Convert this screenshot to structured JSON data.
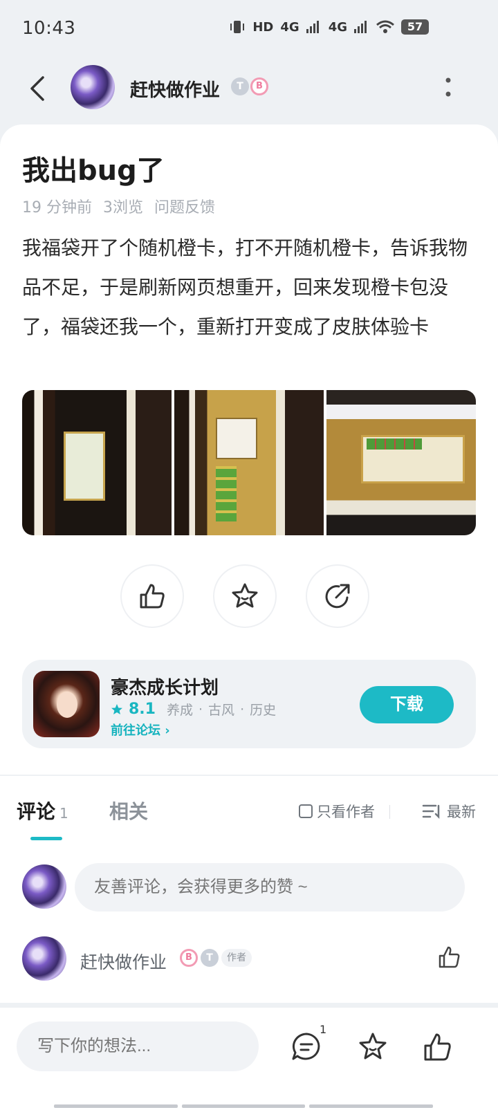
{
  "status_bar": {
    "time": "10:43",
    "network_a": "4G",
    "network_b": "4G",
    "hd_label": "HD",
    "battery": "57"
  },
  "header": {
    "username": "赶快做作业",
    "badge_t": "T",
    "badge_b": "B"
  },
  "post": {
    "title": "我出bug了",
    "time_ago": "19 分钟前",
    "views": "3浏览",
    "category": "问题反馈",
    "body": "我福袋开了个随机橙卡，打不开随机橙卡，告诉我物品不足，于是刷新网页想重开，回来发现橙卡包没了，福袋还我一个，重新打开变成了皮肤体验卡"
  },
  "game": {
    "name": "豪杰成长计划",
    "rating": "8.1",
    "tags": [
      "养成",
      "古风",
      "历史"
    ],
    "forum_link": "前往论坛",
    "download_label": "下载"
  },
  "comments": {
    "tab_comments": "评论",
    "tab_comments_count": "1",
    "tab_related": "相关",
    "only_author": "只看作者",
    "sort_label": "最新",
    "input_placeholder": "友善评论，会获得更多的赞 ~",
    "items": [
      {
        "user": "赶快做作业",
        "tag": "作者"
      }
    ]
  },
  "bottom_bar": {
    "input_placeholder": "写下你的想法...",
    "comment_count": "1"
  },
  "colors": {
    "accent": "#1dbac6",
    "background": "#eef1f4"
  }
}
